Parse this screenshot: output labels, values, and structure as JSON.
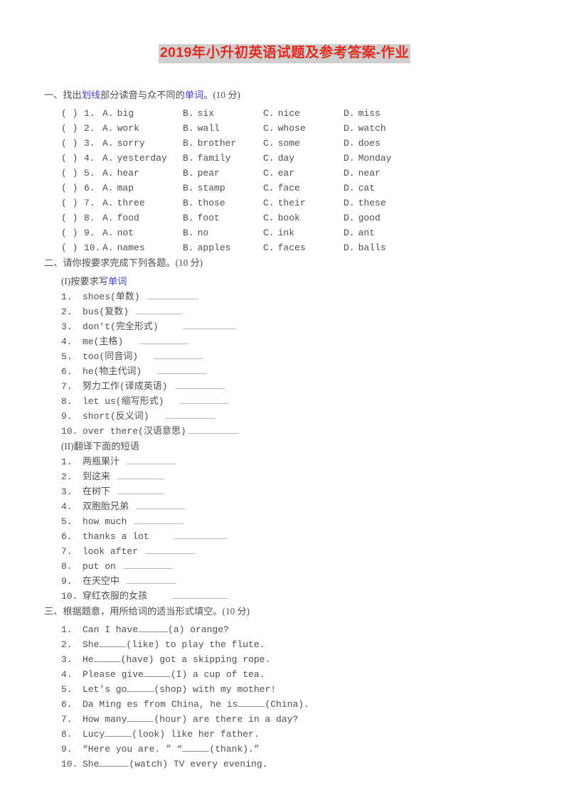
{
  "document": {
    "title": "2019年小升初英语试题及参考答案-作业",
    "title_color": "#e02b1f",
    "title_highlight": "#cfcfcf",
    "link_color": "#4040c8",
    "body_color": "#4f4f4f",
    "page_background": "#ffffff"
  },
  "sections": [
    {
      "id": "section-one",
      "heading_parts": [
        {
          "text": "一、找出",
          "style": "plain"
        },
        {
          "text": "划线",
          "style": "link"
        },
        {
          "text": "部分读音与众不同的",
          "style": "plain"
        },
        {
          "text": "单词",
          "style": "link"
        },
        {
          "text": "。(10 分)",
          "style": "plain"
        }
      ],
      "heading_plain": "一、找出划线部分读音与众不同的单词。(10 分)",
      "type": "multiple-choice",
      "bracket": "(    )",
      "questions": [
        {
          "num": "1.",
          "options": [
            {
              "label": "A.",
              "word": "big"
            },
            {
              "label": "B.",
              "word": "six"
            },
            {
              "label": "C.",
              "word": "nice"
            },
            {
              "label": "D.",
              "word": "miss"
            }
          ]
        },
        {
          "num": "2.",
          "options": [
            {
              "label": "A.",
              "word": "work"
            },
            {
              "label": "B.",
              "word": "wall"
            },
            {
              "label": "C.",
              "word": "whose"
            },
            {
              "label": "D.",
              "word": "watch"
            }
          ]
        },
        {
          "num": "3.",
          "options": [
            {
              "label": "A.",
              "word": "sorry"
            },
            {
              "label": "B.",
              "word": "brother"
            },
            {
              "label": "C.",
              "word": "some"
            },
            {
              "label": "D.",
              "word": "does"
            }
          ]
        },
        {
          "num": "4.",
          "options": [
            {
              "label": "A.",
              "word": "yesterday"
            },
            {
              "label": "B.",
              "word": "family"
            },
            {
              "label": "C.",
              "word": "day"
            },
            {
              "label": "D.",
              "word": "Monday"
            }
          ]
        },
        {
          "num": "5.",
          "options": [
            {
              "label": "A.",
              "word": "hear"
            },
            {
              "label": "B.",
              "word": "pear"
            },
            {
              "label": "C.",
              "word": "ear"
            },
            {
              "label": "D.",
              "word": "near"
            }
          ]
        },
        {
          "num": "6.",
          "options": [
            {
              "label": "A.",
              "word": "map"
            },
            {
              "label": "B.",
              "word": "stamp"
            },
            {
              "label": "C.",
              "word": "face"
            },
            {
              "label": "D.",
              "word": "cat"
            }
          ]
        },
        {
          "num": "7.",
          "options": [
            {
              "label": "A.",
              "word": "three"
            },
            {
              "label": "B.",
              "word": "those"
            },
            {
              "label": "C.",
              "word": "their"
            },
            {
              "label": "D.",
              "word": "these"
            }
          ]
        },
        {
          "num": "8.",
          "options": [
            {
              "label": "A.",
              "word": "food"
            },
            {
              "label": "B.",
              "word": "foot"
            },
            {
              "label": "C.",
              "word": "book"
            },
            {
              "label": "D.",
              "word": "good"
            }
          ]
        },
        {
          "num": "9.",
          "options": [
            {
              "label": "A.",
              "word": "not"
            },
            {
              "label": "B.",
              "word": "no"
            },
            {
              "label": "C.",
              "word": "ink"
            },
            {
              "label": "D.",
              "word": "ant"
            }
          ]
        },
        {
          "num": "10.",
          "options": [
            {
              "label": "A.",
              "word": "names"
            },
            {
              "label": "B.",
              "word": "apples"
            },
            {
              "label": "C.",
              "word": "faces"
            },
            {
              "label": "D.",
              "word": "balls"
            }
          ]
        }
      ]
    },
    {
      "id": "section-two",
      "heading_plain": "二、请你按要求完成下列各题。(10 分)",
      "subsections": [
        {
          "id": "part-one",
          "heading_parts": [
            {
              "text": "(I)按要求写",
              "style": "plain"
            },
            {
              "text": "单词",
              "style": "link"
            }
          ],
          "heading_plain": "(I)按要求写单词",
          "items": [
            {
              "num": "1.",
              "prompt": "shoes(单数)",
              "blank_width": 72,
              "gap": "gap-s"
            },
            {
              "num": "2.",
              "prompt": "bus(复数)",
              "blank_width": 66,
              "gap": "gap-s"
            },
            {
              "num": "3.",
              "prompt": "don't(完全形式)",
              "blank_width": 76,
              "gap": "gap-l"
            },
            {
              "num": "4.",
              "prompt": "me(主格)",
              "blank_width": 70,
              "gap": "gap-m"
            },
            {
              "num": "5.",
              "prompt": "too(同音词)",
              "blank_width": 70,
              "gap": "gap-m"
            },
            {
              "num": "6.",
              "prompt": "he(物主代词)",
              "blank_width": 70,
              "gap": "gap-m"
            },
            {
              "num": "7.",
              "prompt": "努力工作(译成英语)",
              "blank_width": 70,
              "gap": "gap-s"
            },
            {
              "num": "8.",
              "prompt": "let us(缩写形式)",
              "blank_width": 70,
              "gap": "gap-m"
            },
            {
              "num": "9.",
              "prompt": "short(反义词)",
              "blank_width": 70,
              "gap": "gap-m"
            },
            {
              "num": "10.",
              "prompt": "over there(汉语意思)",
              "blank_width": 72,
              "gap": ""
            }
          ]
        },
        {
          "id": "part-two",
          "heading_plain": "(II)翻译下面的短语",
          "items": [
            {
              "num": "1.",
              "prompt": "两瓶果汁",
              "blank_width": 70,
              "gap": "gap-s"
            },
            {
              "num": "2.",
              "prompt": "到这来",
              "blank_width": 66,
              "gap": "gap-s"
            },
            {
              "num": "3.",
              "prompt": "在树下",
              "blank_width": 66,
              "gap": "gap-s"
            },
            {
              "num": "4.",
              "prompt": "双胞胎兄弟",
              "blank_width": 70,
              "gap": "gap-s"
            },
            {
              "num": "5.",
              "prompt": "how much",
              "blank_width": 70,
              "gap": "gap-s"
            },
            {
              "num": "6.",
              "prompt": "thanks a lot",
              "blank_width": 76,
              "gap": "gap-l"
            },
            {
              "num": "7.",
              "prompt": "look after",
              "blank_width": 70,
              "gap": "gap-s"
            },
            {
              "num": "8.",
              "prompt": "put on",
              "blank_width": 70,
              "gap": "gap-s"
            },
            {
              "num": "9.",
              "prompt": "在天空中",
              "blank_width": 70,
              "gap": "gap-s"
            },
            {
              "num": "10.",
              "prompt": "穿红衣服的女孩",
              "blank_width": 80,
              "gap": "gap-l"
            }
          ]
        }
      ]
    },
    {
      "id": "section-three",
      "heading_plain": "三、根据题意，用所给词的适当形式填空。(10 分)",
      "items": [
        {
          "num": "1.",
          "before": "Can I have ",
          "blank_width": 42,
          "after": "(a) orange?"
        },
        {
          "num": "2.",
          "before": "She ",
          "blank_width": 38,
          "after": "(like) to play the flute."
        },
        {
          "num": "3.",
          "before": "He ",
          "blank_width": 38,
          "after": "(have) got a skipping rope."
        },
        {
          "num": "4.",
          "before": "Please give ",
          "blank_width": 38,
          "after": "(I) a cup of tea."
        },
        {
          "num": "5.",
          "before": "Let's go ",
          "blank_width": 38,
          "after": "(shop) with my mother!"
        },
        {
          "num": "6.",
          "before": "Da Ming es from China, he is ",
          "blank_width": 38,
          "after": "(China)."
        },
        {
          "num": "7.",
          "before": "How many ",
          "blank_width": 38,
          "after": "(hour) are there in a day?"
        },
        {
          "num": "8.",
          "before": "Lucy ",
          "blank_width": 38,
          "after": "(look) like her father."
        },
        {
          "num": "9.",
          "before": "“Here you are. ” “",
          "blank_width": 38,
          "after": "(thank).”"
        },
        {
          "num": "10.",
          "before": "She ",
          "blank_width": 42,
          "after": "(watch) TV every evening."
        }
      ]
    }
  ]
}
